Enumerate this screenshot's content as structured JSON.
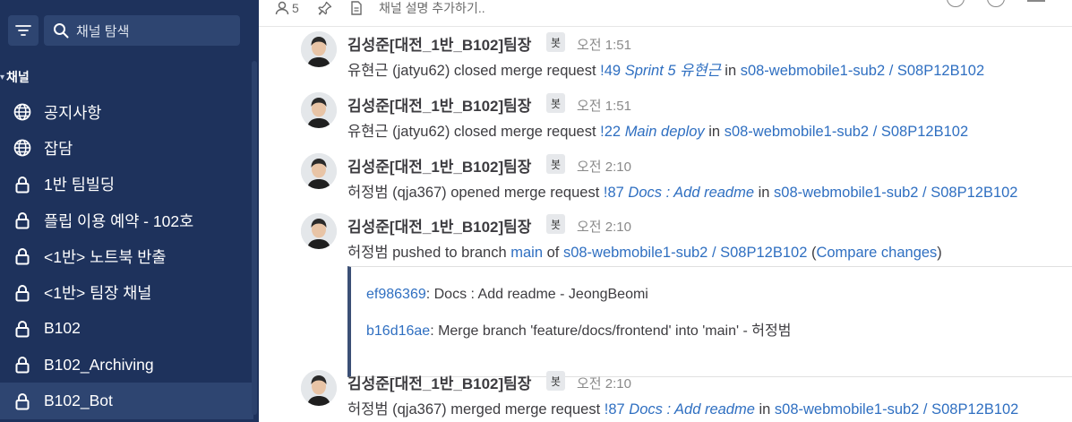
{
  "sidebar": {
    "search_placeholder": "채널 탐색",
    "section_label": "채널",
    "channels": [
      {
        "label": "공지사항",
        "icon": "globe-icon"
      },
      {
        "label": "잡담",
        "icon": "globe-icon"
      },
      {
        "label": "1반 팀빌딩",
        "icon": "lock-icon"
      },
      {
        "label": "플립 이용 예약 - 102호",
        "icon": "lock-icon"
      },
      {
        "label": "<1반> 노트북 반출",
        "icon": "lock-icon"
      },
      {
        "label": "<1반> 팀장 채널",
        "icon": "lock-icon"
      },
      {
        "label": "B102",
        "icon": "lock-icon"
      },
      {
        "label": "B102_Archiving",
        "icon": "lock-icon"
      },
      {
        "label": "B102_Bot",
        "icon": "lock-icon",
        "active": true
      }
    ]
  },
  "header": {
    "member_count": "5",
    "description_placeholder": "채널 설명 추가하기.."
  },
  "posts": [
    {
      "author": "김성준[대전_1반_B102]팀장",
      "badge": "봇",
      "time": "오전 1:51",
      "msg": {
        "prefix": "유현근 (jatyu62) closed merge request ",
        "mr": "!49",
        "title": "Sprint 5 유현근",
        "mid": " in ",
        "repo": "s08-webmobile1-sub2 / S08P12B102"
      }
    },
    {
      "author": "김성준[대전_1반_B102]팀장",
      "badge": "봇",
      "time": "오전 1:51",
      "msg": {
        "prefix": "유현근 (jatyu62) closed merge request ",
        "mr": "!22",
        "title": "Main deploy",
        "mid": " in ",
        "repo": "s08-webmobile1-sub2 / S08P12B102"
      }
    },
    {
      "author": "김성준[대전_1반_B102]팀장",
      "badge": "봇",
      "time": "오전 2:10",
      "msg": {
        "prefix": "허정범 (qja367) opened merge request ",
        "mr": "!87",
        "title": "Docs : Add readme",
        "mid": " in ",
        "repo": "s08-webmobile1-sub2 / S08P12B102"
      }
    },
    {
      "author": "김성준[대전_1반_B102]팀장",
      "badge": "봇",
      "time": "오전 2:10",
      "push": {
        "prefix": "허정범 pushed to branch ",
        "branch": "main",
        "of": " of ",
        "repo": "s08-webmobile1-sub2 / S08P12B102",
        "paren_open": " (",
        "compare": "Compare changes",
        "paren_close": ")"
      },
      "commits": [
        {
          "sha": "ef986369",
          "text": ": Docs : Add readme - JeongBeomi"
        },
        {
          "sha": "b16d16ae",
          "text": ": Merge branch 'feature/docs/frontend' into 'main' - 허정범"
        }
      ]
    },
    {
      "author": "김성준[대전_1반_B102]팀장",
      "badge": "봇",
      "time": "오전 2:10",
      "msg": {
        "prefix": "허정범 (qja367) merged merge request ",
        "mr": "!87",
        "title": "Docs : Add readme",
        "mid": " in ",
        "repo": "s08-webmobile1-sub2 / S08P12B102"
      }
    }
  ],
  "colors": {
    "sidebar_bg": "#1e325c",
    "link": "#2f6fc1",
    "active_item": "#2e4571"
  }
}
